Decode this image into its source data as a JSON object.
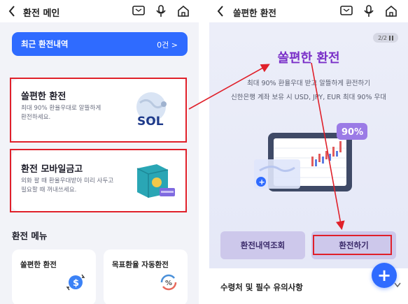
{
  "left": {
    "header_title": "환전 메인",
    "recent": {
      "label": "최근 환전내역",
      "count": "0건"
    },
    "card1": {
      "title": "쏠편한 환전",
      "desc1": "최대 90% 환율우대로 알뜰하게",
      "desc2": "환전하세요.",
      "art_text": "SOL"
    },
    "card2": {
      "title": "환전 모바일금고",
      "desc1": "외화 팔 때 환율우대받아 미리 사두고",
      "desc2": "필요할 때 꺼내쓰세요."
    },
    "menu_title": "환전 메뉴",
    "menu_items": [
      {
        "label": "쏠편한 환전"
      },
      {
        "label": "목표환율 자동환전"
      }
    ]
  },
  "right": {
    "header_title": "쏠편한 환전",
    "pager": "2/2",
    "title": "쏠편한 환전",
    "sub1": "최대 90% 환율우대 받고 알뜰하게 환전하기",
    "sub2": "신한은행 계좌 보유 시 USD, JPY, EUR 최대 90% 우대",
    "badge": "90%",
    "buttons": {
      "history": "환전내역조회",
      "exchange": "환전하기"
    },
    "fab": "+",
    "footer": "수령처 및 필수 유의사항"
  },
  "colors": {
    "accent_blue": "#2f6bff",
    "highlight_red": "#e0202a",
    "title_purple": "#7a2fc8",
    "button_lavender": "#cdc8eb"
  }
}
